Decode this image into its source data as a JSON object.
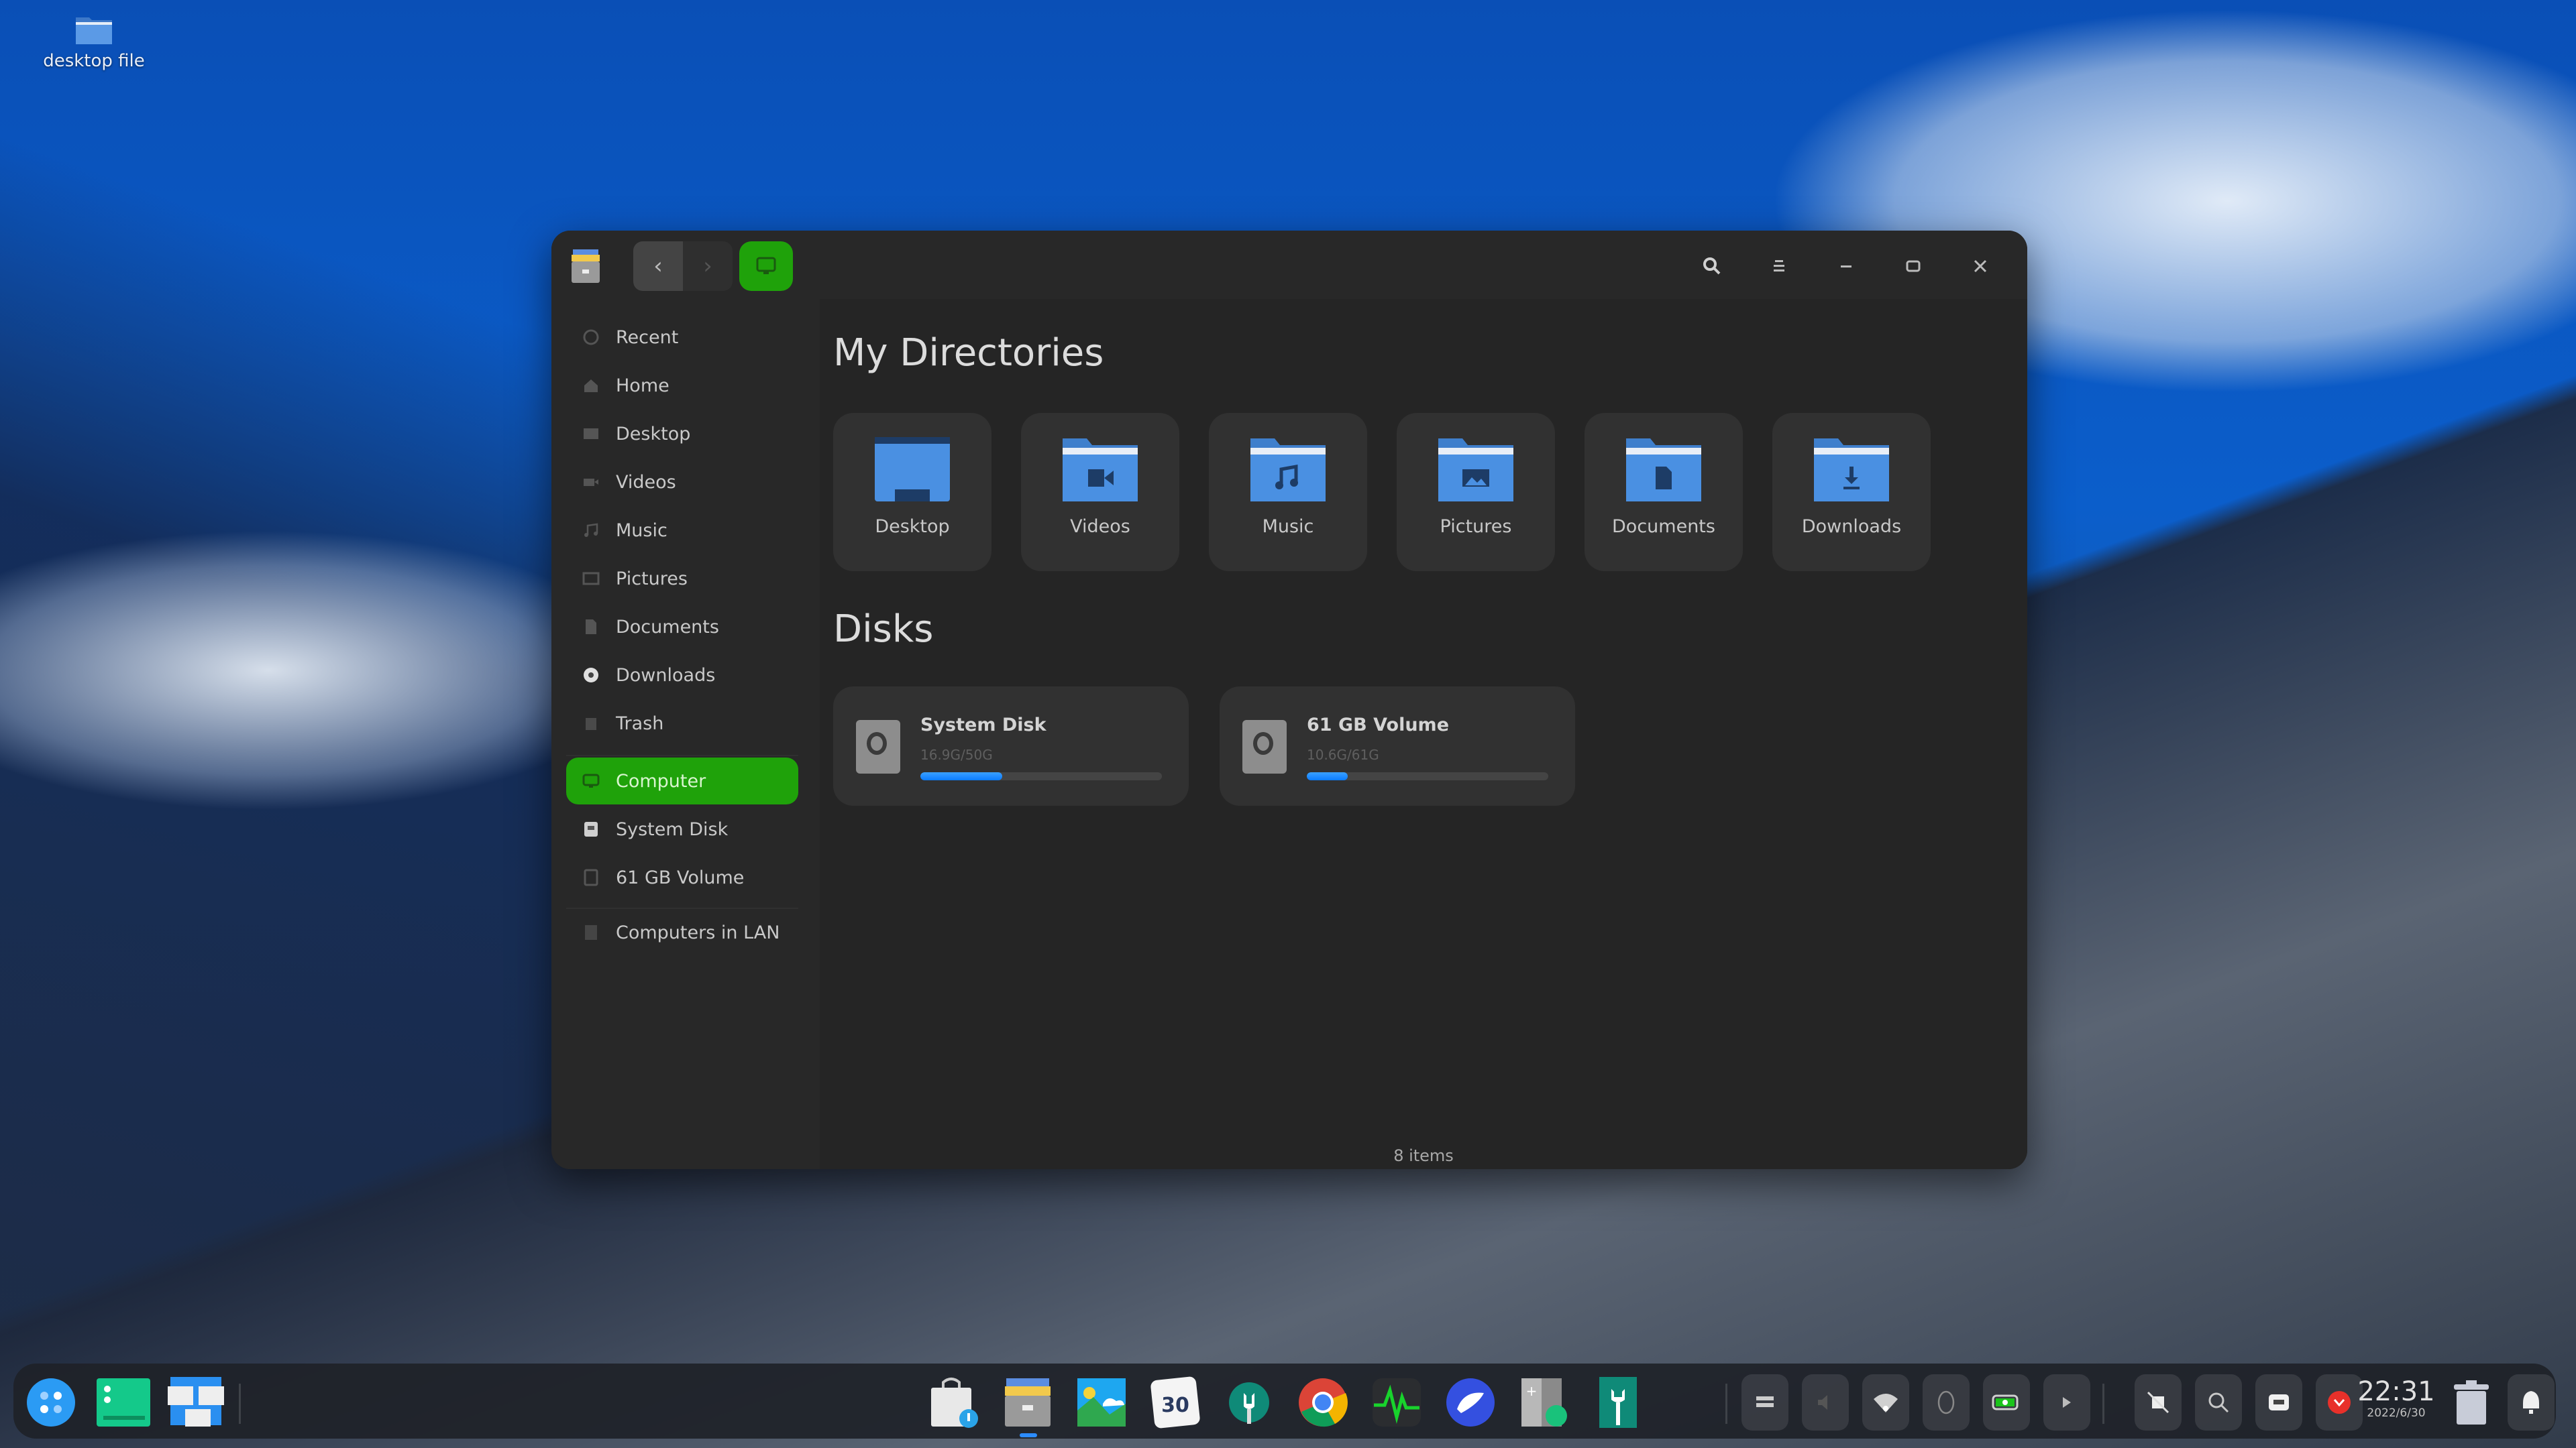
{
  "desktop": {
    "icons": [
      {
        "label": "desktop file",
        "icon": "folder-icon"
      }
    ]
  },
  "window": {
    "toolbar": {
      "app_icon": "file-manager-icon",
      "back": "‹",
      "forward": "›",
      "breadcrumb_icon": "computer-icon",
      "search": "search-icon",
      "menu": "menu-icon",
      "minimize": "minimize-icon",
      "maximize": "maximize-icon",
      "close": "close-icon"
    },
    "sidebar": {
      "items": [
        {
          "label": "Recent",
          "icon": "clock-icon"
        },
        {
          "label": "Home",
          "icon": "home-icon"
        },
        {
          "label": "Desktop",
          "icon": "desktop-icon"
        },
        {
          "label": "Videos",
          "icon": "video-icon"
        },
        {
          "label": "Music",
          "icon": "music-icon"
        },
        {
          "label": "Pictures",
          "icon": "picture-icon"
        },
        {
          "label": "Documents",
          "icon": "document-icon"
        },
        {
          "label": "Downloads",
          "icon": "download-icon"
        },
        {
          "label": "Trash",
          "icon": "trash-icon"
        },
        {
          "label": "Computer",
          "icon": "computer-icon",
          "active": true
        },
        {
          "label": "System Disk",
          "icon": "disk-icon"
        },
        {
          "label": "61 GB Volume",
          "icon": "disk-icon"
        },
        {
          "label": "Computers in LAN",
          "icon": "network-icon"
        }
      ]
    },
    "main": {
      "directories_title": "My Directories",
      "directories": [
        {
          "label": "Desktop",
          "icon": "desktop-folder-icon"
        },
        {
          "label": "Videos",
          "icon": "videos-folder-icon"
        },
        {
          "label": "Music",
          "icon": "music-folder-icon"
        },
        {
          "label": "Pictures",
          "icon": "pictures-folder-icon"
        },
        {
          "label": "Documents",
          "icon": "documents-folder-icon"
        },
        {
          "label": "Downloads",
          "icon": "downloads-folder-icon"
        }
      ],
      "disks_title": "Disks",
      "disks": [
        {
          "name": "System Disk",
          "usage": "16.9G/50G",
          "used_fraction": 0.34
        },
        {
          "name": "61 GB Volume",
          "usage": "10.6G/61G",
          "used_fraction": 0.17
        }
      ],
      "status": "8 items"
    }
  },
  "dock": {
    "left_apps": [
      {
        "name": "launcher",
        "icon": "launcher-icon"
      },
      {
        "name": "show-desktop",
        "icon": "show-desktop-icon"
      },
      {
        "name": "multitasking",
        "icon": "multitask-view-icon"
      }
    ],
    "apps": [
      {
        "name": "app-store",
        "icon": "app-store-icon"
      },
      {
        "name": "file-manager",
        "icon": "file-manager-icon",
        "running": true
      },
      {
        "name": "image-viewer",
        "icon": "image-viewer-icon"
      },
      {
        "name": "calendar",
        "icon": "calendar-icon",
        "text": "30"
      },
      {
        "name": "control-center",
        "icon": "settings-icon"
      },
      {
        "name": "chrome",
        "icon": "chrome-icon"
      },
      {
        "name": "system-monitor",
        "icon": "system-monitor-icon"
      },
      {
        "name": "browser",
        "icon": "browser-icon"
      },
      {
        "name": "calculator",
        "icon": "calculator-icon"
      },
      {
        "name": "dev-tool",
        "icon": "tool-icon"
      }
    ],
    "tray": [
      {
        "name": "keyboard",
        "icon": "keyboard-icon"
      },
      {
        "name": "sound",
        "icon": "volume-icon"
      },
      {
        "name": "wifi",
        "icon": "wifi-icon"
      },
      {
        "name": "mouse",
        "icon": "mouse-icon"
      },
      {
        "name": "battery",
        "icon": "battery-icon"
      },
      {
        "name": "expand",
        "icon": "expand-arrow-icon"
      },
      {
        "name": "screenshot",
        "icon": "screenshot-icon"
      },
      {
        "name": "search",
        "icon": "search-icon"
      },
      {
        "name": "display",
        "icon": "display-icon"
      },
      {
        "name": "power",
        "icon": "power-icon"
      }
    ],
    "clock": {
      "time": "22:31",
      "date": "2022/6/30"
    },
    "trash": "trash-icon",
    "notifications": "bell-icon"
  },
  "colors": {
    "accent_green": "#1fa20a",
    "progress_blue": "#1a8cff",
    "folder_blue": "#4a90e2"
  }
}
